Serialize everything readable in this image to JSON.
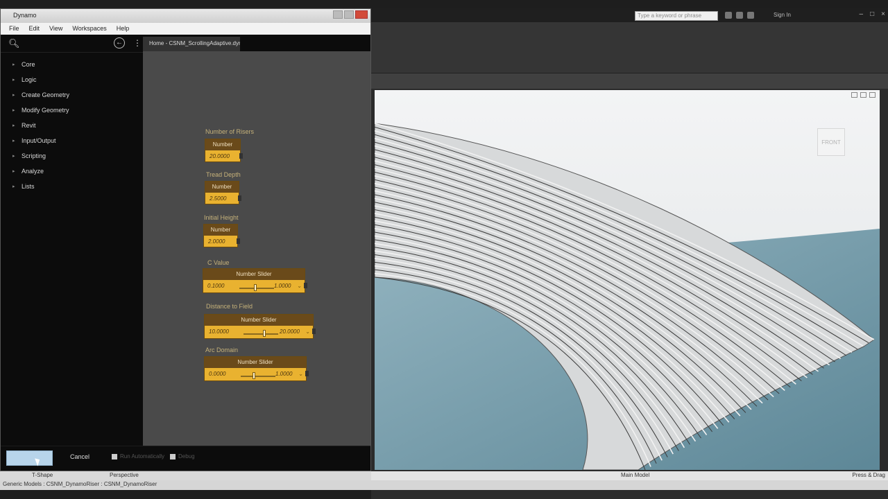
{
  "host": {
    "search_placeholder": "Type a keyword or phrase",
    "user": "Sign In",
    "status_left": "Generic Models : CSNM_DynamoRiser : CSNM_DynamoRiser",
    "view_label": "Perspective",
    "tshape_label": "T-Shape",
    "status_right": "Press & Drag",
    "main_model": "Main Model",
    "navcube": "FRONT"
  },
  "dynamo": {
    "title": "Dynamo",
    "menu": [
      "File",
      "Edit",
      "View",
      "Workspaces",
      "Help"
    ],
    "tab_label": "Home - CSNM_ScrollingAdaptive.dyn",
    "library": [
      "Core",
      "Logic",
      "Create Geometry",
      "Modify Geometry",
      "Revit",
      "Input/Output",
      "Scripting",
      "Analyze",
      "Lists"
    ],
    "nodes": [
      {
        "label": "Number of Risers",
        "header": "Number",
        "value": "20.0000"
      },
      {
        "label": "Tread Depth",
        "header": "Number",
        "value": "2.5000"
      },
      {
        "label": "Initial Height",
        "header": "Number",
        "value": "2.0000"
      }
    ],
    "sliders": [
      {
        "label": "C Value",
        "header": "Number Slider",
        "min": "0.1000",
        "max": "1.0000",
        "pos": 0.45
      },
      {
        "label": "Distance to Field",
        "header": "Number Slider",
        "min": "10.0000",
        "max": "20.0000",
        "pos": 0.6
      },
      {
        "label": "Arc Domain",
        "header": "Number Slider",
        "min": "0.0000",
        "max": "1.0000",
        "pos": 0.38
      }
    ],
    "bottom": {
      "cancel": "Cancel",
      "check1": "Run Automatically",
      "check2": "Debug"
    }
  },
  "colors": {
    "node": "#e9b230",
    "node_header": "#6a4a1a",
    "viewport_water": "#7fa3b1",
    "run_button": "#b7d4ea"
  }
}
